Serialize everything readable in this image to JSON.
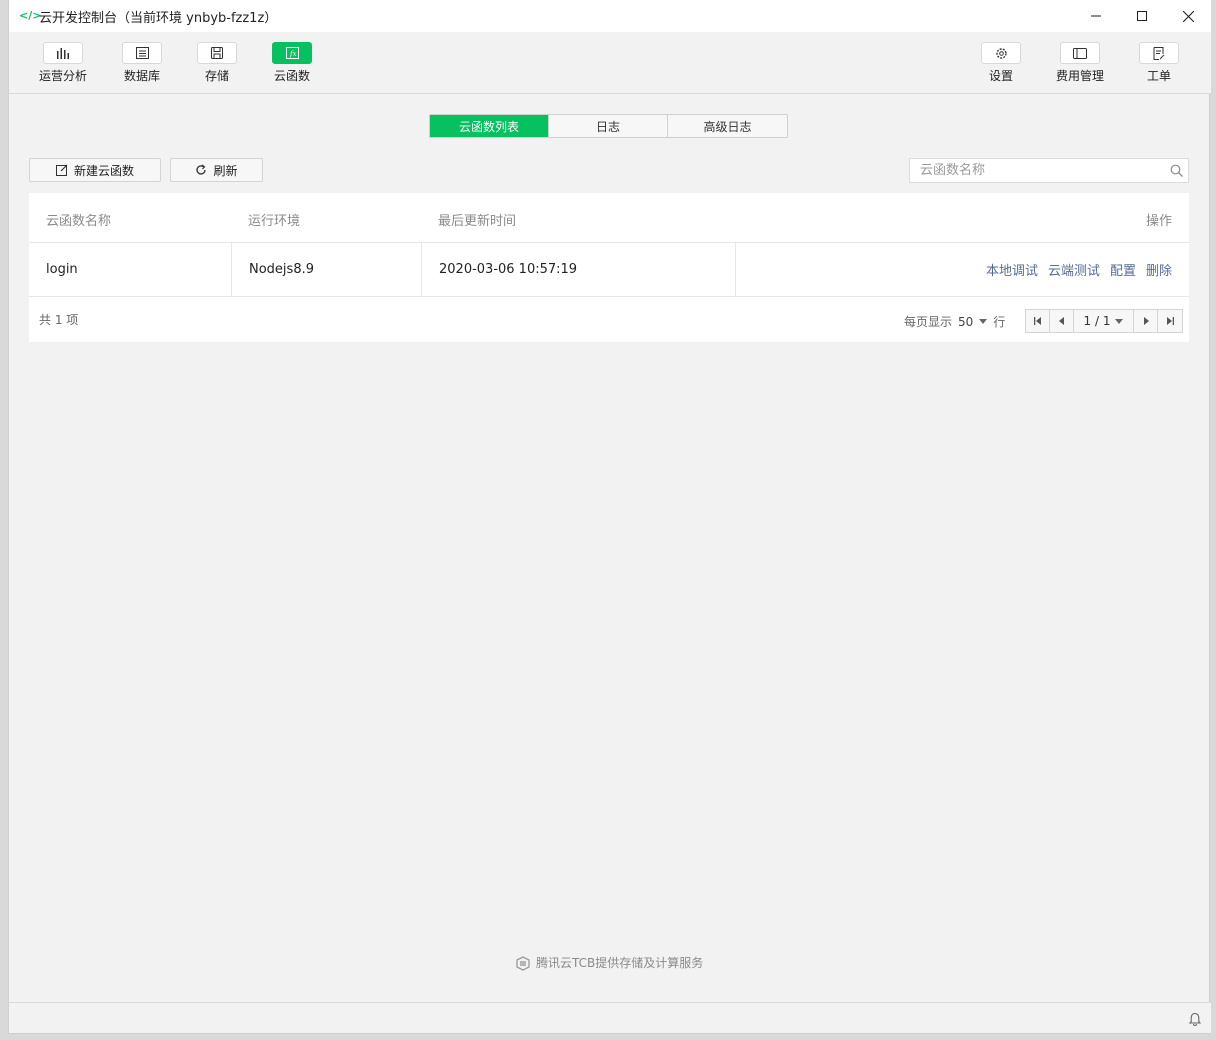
{
  "window": {
    "title": "云开发控制台（当前环境 ynbyb-fzz1z）"
  },
  "toolbar": {
    "left": [
      {
        "label": "运营分析",
        "icon": "chart-icon"
      },
      {
        "label": "数据库",
        "icon": "database-icon"
      },
      {
        "label": "存储",
        "icon": "storage-icon"
      },
      {
        "label": "云函数",
        "icon": "function-icon"
      }
    ],
    "right": [
      {
        "label": "设置",
        "icon": "gear-icon"
      },
      {
        "label": "费用管理",
        "icon": "billing-icon"
      },
      {
        "label": "工单",
        "icon": "ticket-icon"
      }
    ],
    "active": "云函数"
  },
  "tabs": [
    {
      "label": "云函数列表",
      "active": true
    },
    {
      "label": "日志",
      "active": false
    },
    {
      "label": "高级日志",
      "active": false
    }
  ],
  "actions": {
    "new_label": "新建云函数",
    "refresh_label": "刷新",
    "search_placeholder": "云函数名称"
  },
  "table": {
    "columns": [
      "云函数名称",
      "运行环境",
      "最后更新时间",
      "操作"
    ],
    "rows": [
      {
        "name": "login",
        "runtime": "Nodejs8.9",
        "updated": "2020-03-06 10:57:19",
        "ops": [
          "本地调试",
          "云端测试",
          "配置",
          "删除"
        ]
      }
    ],
    "total": "共 1 项",
    "per_page_label": "每页显示",
    "per_page_value": "50",
    "per_page_unit": "行",
    "page": "1 / 1"
  },
  "footer": {
    "brand": "腾讯云TCB提供存储及计算服务"
  },
  "colors": {
    "accent": "#07c160",
    "link": "#576b95"
  }
}
